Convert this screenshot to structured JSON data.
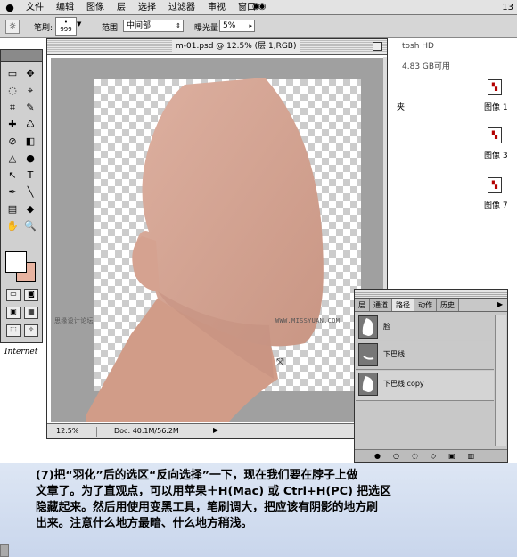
{
  "menubar": {
    "apple": "",
    "items": [
      "文件",
      "编辑",
      "图像",
      "层",
      "选择",
      "过滤器",
      "审视",
      "窗口"
    ],
    "page_number": "13"
  },
  "options_bar": {
    "brush_label": "笔刷:",
    "brush_size": "999",
    "range_label": "范围:",
    "range_value": "中间部",
    "exposure_label": "曝光量:",
    "exposure_value": "5%"
  },
  "desktop": {
    "disk_title": "tosh HD",
    "disk_free": "4.83 GB可用",
    "side_char": "夹",
    "files": [
      "图像 1",
      "图像 3",
      "图像 7"
    ]
  },
  "toolbox": {
    "tools": [
      "▭",
      "✥",
      "◌",
      "⌖",
      "⌗",
      "✎",
      "✚",
      "♺",
      "⊘",
      "◧",
      "△",
      "●",
      "↖",
      "T",
      "✒",
      "╲",
      "▤",
      "◆",
      "✋",
      "🔍"
    ]
  },
  "internet_label": "Internet",
  "document": {
    "title": "m-01.psd @ 12.5% (层 1,RGB)",
    "zoom": "12.5%",
    "doc_size": "Doc: 40.1M/56.2M"
  },
  "watermarks": {
    "left": "思缘设计论坛",
    "right": "WWW.MISSYUAN.COM"
  },
  "panel": {
    "tabs": [
      "层",
      "通道",
      "路径",
      "动作",
      "历史"
    ],
    "active_tab": 2,
    "paths": [
      "脸",
      "下巴线",
      "下巴线 copy"
    ]
  },
  "instruction": "(7)把“羽化”后的选区“反向选择”一下，现在我们要在脖子上做\n文章了。为了直观点，可以用苹果＋H(Mac) 或 Ctrl+H(PC) 把选区\n隐藏起来。然后用使用变黑工具，笔刷调大，把应该有阴影的地方刷\n出来。注意什么地方最暗、什么地方稍浅。",
  "colors": {
    "skin": "#d9a896",
    "skin_shadow": "#c08d7b",
    "background_swatch": "#e8b3a0",
    "instruction_bg": "#d3dff0"
  }
}
